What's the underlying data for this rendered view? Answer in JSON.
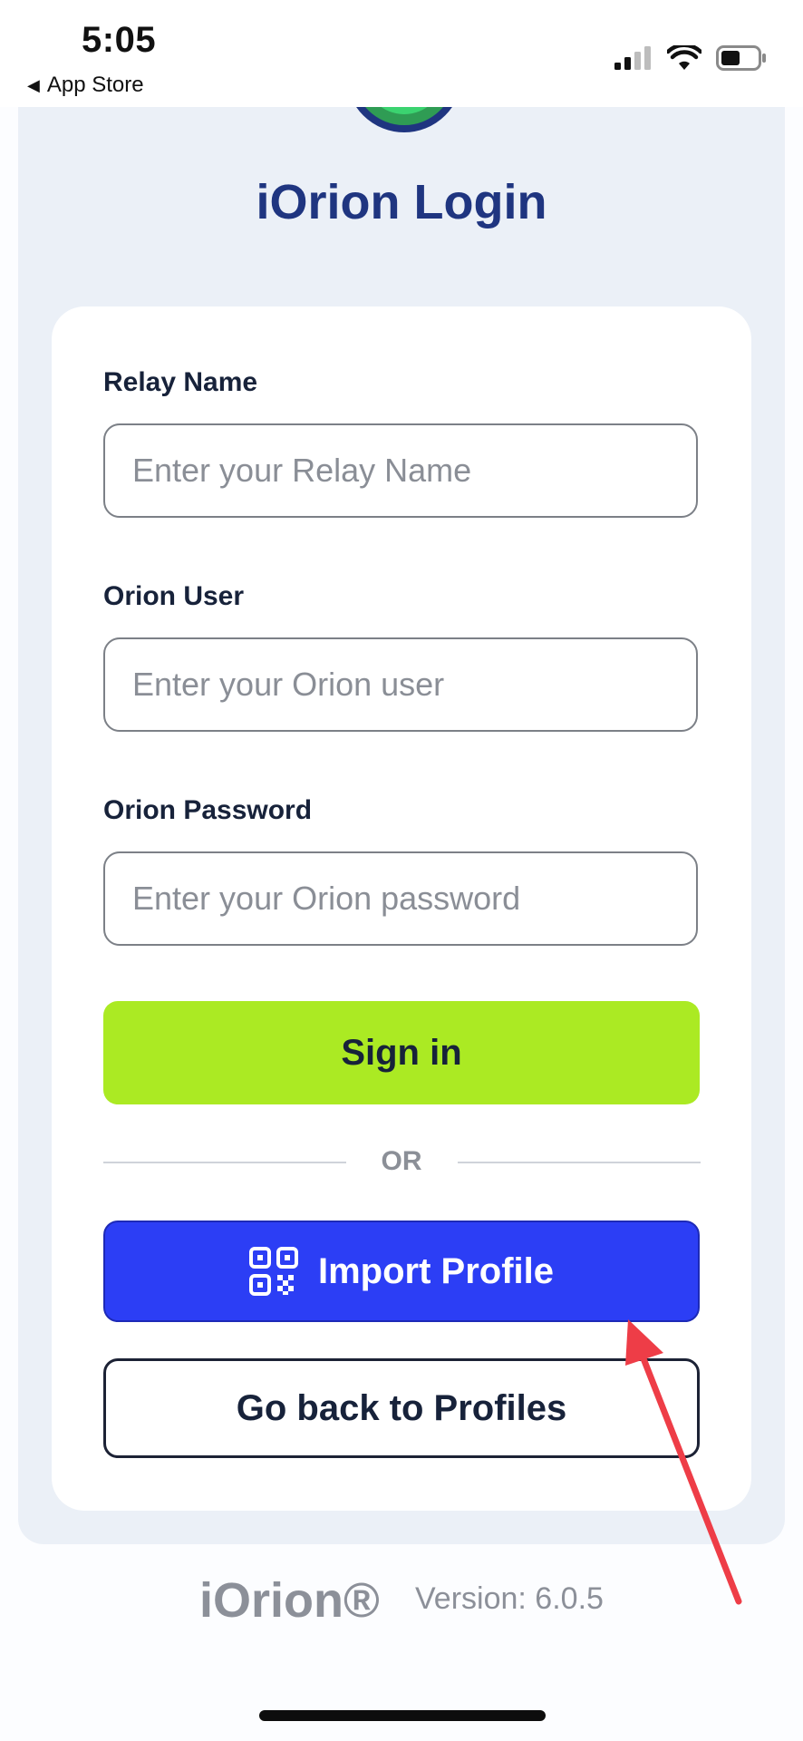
{
  "status_bar": {
    "time": "5:05",
    "back_label": "App Store",
    "icons": [
      "cellular-signal-icon",
      "wifi-icon",
      "battery-icon"
    ]
  },
  "login": {
    "title": "iOrion Login",
    "relay_name": {
      "label": "Relay Name",
      "placeholder": "Enter your Relay Name",
      "value": ""
    },
    "orion_user": {
      "label": "Orion User",
      "placeholder": "Enter your Orion user",
      "value": ""
    },
    "orion_password": {
      "label": "Orion Password",
      "placeholder": "Enter your Orion password",
      "value": ""
    },
    "sign_in_label": "Sign in",
    "or_label": "OR",
    "import_profile_label": "Import Profile",
    "import_icon": "qr-code-icon",
    "go_back_label": "Go back to Profiles"
  },
  "footer": {
    "brand": "iOrion®",
    "version": "Version: 6.0.5"
  },
  "colors": {
    "title": "#1f3580",
    "sign_in_bg": "#abea23",
    "import_bg": "#2c3ef5",
    "panel_bg": "#ebf0f7",
    "annotation_arrow": "#ee3d47"
  }
}
